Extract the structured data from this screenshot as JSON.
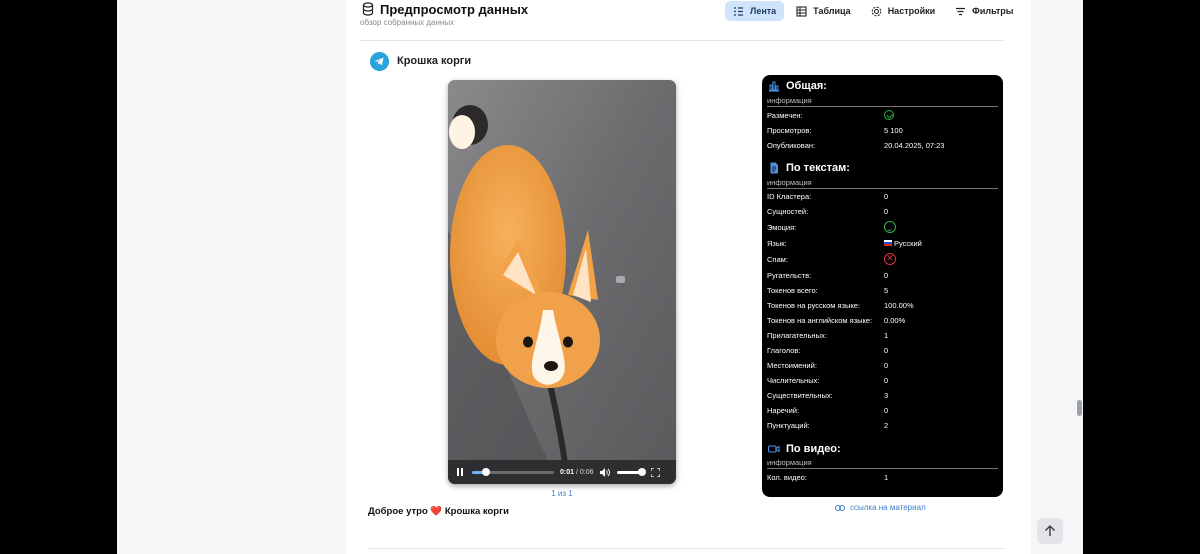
{
  "header": {
    "title": "Предпросмотр данных",
    "subtitle": "обзор собранных данных",
    "tabs": [
      {
        "label": "Лента",
        "icon": "feed-icon",
        "active": true
      },
      {
        "label": "Таблица",
        "icon": "table-icon",
        "active": false
      },
      {
        "label": "Настройки",
        "icon": "gear-icon",
        "active": false
      },
      {
        "label": "Фильтры",
        "icon": "filter-icon",
        "active": false
      }
    ]
  },
  "post": {
    "channel": "Крошка корги",
    "caption_before": "Доброе утро",
    "caption_emoji": "❤️",
    "caption_after": "Крошка корги",
    "pager": "1 из 1",
    "link_label": "ссылка на материал"
  },
  "video": {
    "current_time": "0:01",
    "time_separator": " / ",
    "duration": "0:06",
    "progress_fraction": 0.17,
    "volume_fraction": 1.0
  },
  "info": {
    "general": {
      "title": "Общая:",
      "sub": "информация",
      "rows": [
        {
          "key": "Размечен:",
          "value": "",
          "icon": "check-circle-icon"
        },
        {
          "key": "Просмотров:",
          "value": "5 100"
        },
        {
          "key": "Опубликован:",
          "value": "20.04.2025, 07:23"
        }
      ]
    },
    "texts": {
      "title": "По текстам:",
      "sub": "информация",
      "rows": [
        {
          "key": "ID Кластера:",
          "value": "0"
        },
        {
          "key": "Сущностей:",
          "value": "0"
        },
        {
          "key": "Эмоция:",
          "value": "",
          "icon": "smile-icon"
        },
        {
          "key": "Язык:",
          "value": "Русский",
          "icon": "ru-flag-icon"
        },
        {
          "key": "Спам:",
          "value": "",
          "icon": "x-circle-icon"
        },
        {
          "key": "Ругательств:",
          "value": "0"
        },
        {
          "key": "Токенов всего:",
          "value": "5"
        },
        {
          "key": "Токенов на русском языке:",
          "value": "100.00%"
        },
        {
          "key": "Токенов на английском языке:",
          "value": "0.00%"
        },
        {
          "key": "Прилагательных:",
          "value": "1"
        },
        {
          "key": "Глаголов:",
          "value": "0"
        },
        {
          "key": "Местоимений:",
          "value": "0"
        },
        {
          "key": "Числительных:",
          "value": "0"
        },
        {
          "key": "Существительных:",
          "value": "3"
        },
        {
          "key": "Наречий:",
          "value": "0"
        },
        {
          "key": "Пунктуаций:",
          "value": "2"
        }
      ]
    },
    "video": {
      "title": "По видео:",
      "sub": "информация",
      "rows": [
        {
          "key": "Кол. видео:",
          "value": "1"
        }
      ]
    }
  },
  "colors": {
    "accent": "#3f7fc9",
    "active_tab": "#cfe4fb",
    "panel_bg": "#000000",
    "positive": "#2bb04a",
    "negative": "#e0333c",
    "telegram": "#2aa3dd"
  }
}
